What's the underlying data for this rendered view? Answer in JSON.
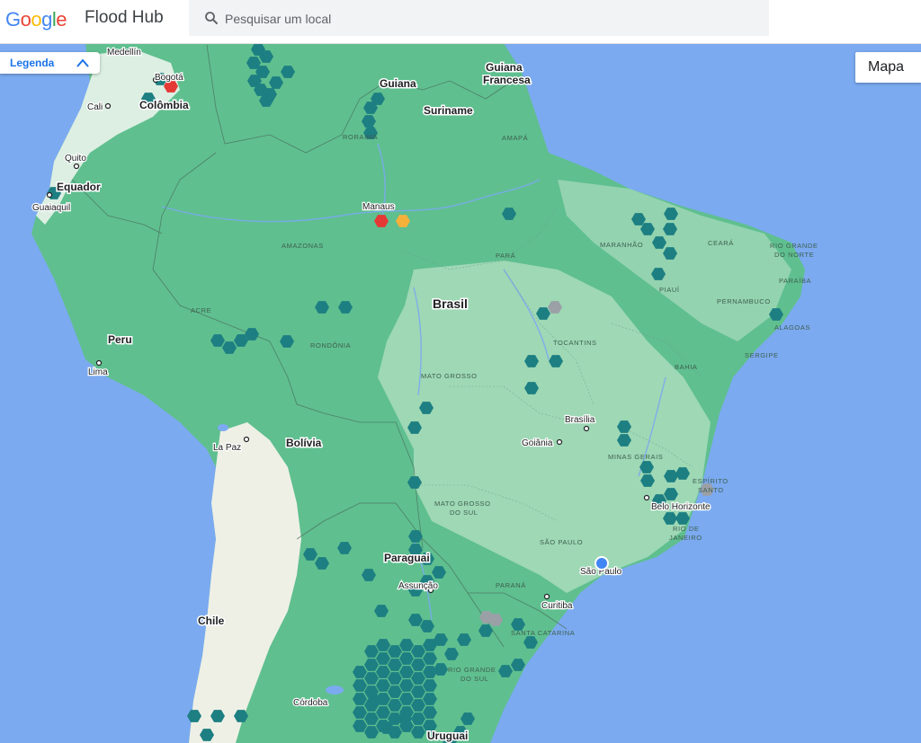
{
  "header": {
    "logo_letters": [
      {
        "ch": "G",
        "color": "#4285f4"
      },
      {
        "ch": "o",
        "color": "#ea4335"
      },
      {
        "ch": "o",
        "color": "#fbbc05"
      },
      {
        "ch": "g",
        "color": "#4285f4"
      },
      {
        "ch": "l",
        "color": "#34a853"
      },
      {
        "ch": "e",
        "color": "#ea4335"
      }
    ],
    "product": "Flood Hub",
    "search_placeholder": "Pesquisar um local"
  },
  "controls": {
    "legend_label": "Legenda",
    "map_type_label": "Mapa"
  },
  "labels": {
    "countries": {
      "guiana_francesa_1": "Guiana",
      "guiana_francesa_2": "Francesa",
      "guiana": "Guiana",
      "suriname": "Suriname",
      "colombia": "Colômbia",
      "equador": "Equador",
      "peru": "Peru",
      "bolivia": "Bolívia",
      "paraguai": "Paraguai",
      "chile": "Chile",
      "uruguai": "Uruguai",
      "brasil": "Brasil"
    },
    "cities": {
      "medellin": "Medellín",
      "bogota": "Bogotá",
      "cali": "Cali",
      "quito": "Quito",
      "guaiaquil": "Guaiaquil",
      "lima": "Lima",
      "la_paz": "La Paz",
      "manaus": "Manaus",
      "brasilia": "Brasília",
      "goiania": "Goiânia",
      "belo_horizonte": "Belo Horizonte",
      "sao_paulo": "São Paulo",
      "curitiba": "Curitiba",
      "assuncao": "Assunção",
      "cordoba": "Córdoba"
    },
    "states": {
      "roraima": "RORAIMA",
      "amapa": "AMAPÁ",
      "amazonas": "AMAZONAS",
      "para": "PARÁ",
      "maranhao": "MARANHÃO",
      "ceara": "CEARÁ",
      "rn_1": "RIO GRANDE",
      "rn_2": "DO NORTE",
      "paraiba": "PARAÍBA",
      "piaui": "PIAUÍ",
      "pernambuco": "PERNAMBUCO",
      "alagoas": "ALAGOAS",
      "acre": "ACRE",
      "rondonia": "RONDÔNIA",
      "tocantins": "TOCANTINS",
      "mato_grosso": "MATO GROSSO",
      "bahia": "BAHIA",
      "sergipe": "SERGIPE",
      "minas_gerais": "MINAS GERAIS",
      "espirito_1": "ESPÍRITO",
      "espirito_2": "SANTO",
      "ms_1": "MATO GROSSO",
      "ms_2": "DO SUL",
      "sao_paulo": "SÃO PAULO",
      "rj_1": "RIO DE",
      "rj_2": "JANEIRO",
      "parana": "PARANÁ",
      "santa_catarina": "SANTA CATARINA",
      "rs_1": "RIO GRANDE",
      "rs_2": "DO SUL"
    }
  },
  "colors": {
    "ocean": "#7baaf0",
    "land": "#5fbf8f",
    "land_light": "#a9dcbc",
    "andes": "#eef0e6",
    "alert_teal": "#1d7f82",
    "alert_red": "#e53935",
    "alert_orange": "#f6b13b",
    "no_data_gray": "#9aa0a6",
    "location_dot": "#4285f4"
  }
}
